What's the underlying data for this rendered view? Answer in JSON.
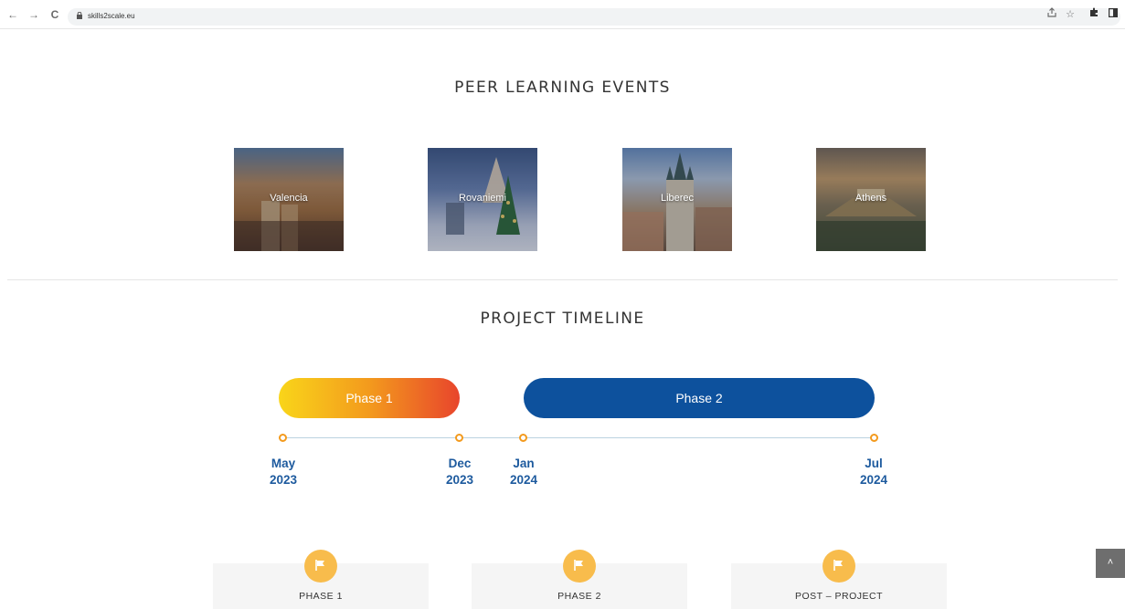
{
  "browser": {
    "url": "skills2scale.eu",
    "nav_back": "←",
    "nav_forward": "→",
    "nav_reload": "C",
    "share_icon": "share-icon",
    "bookmark_icon": "star-icon",
    "extensions_icon": "puzzle-icon",
    "sidepanel_icon": "sidepanel-icon"
  },
  "peer_learning": {
    "title": "PEER LEARNING EVENTS",
    "cities": [
      {
        "label": "Valencia"
      },
      {
        "label": "Rovaniemi"
      },
      {
        "label": "Liberec"
      },
      {
        "label": "Athens"
      }
    ]
  },
  "timeline": {
    "title": "PROJECT TIMELINE",
    "phases": [
      {
        "label": "Phase 1"
      },
      {
        "label": "Phase 2"
      }
    ],
    "dates": [
      {
        "month": "May",
        "year": "2023"
      },
      {
        "month": "Dec",
        "year": "2023"
      },
      {
        "month": "Jan",
        "year": "2024"
      },
      {
        "month": "Jul",
        "year": "2024"
      }
    ]
  },
  "stages": [
    {
      "label": "PHASE 1",
      "icon": "flag-icon"
    },
    {
      "label": "PHASE 2",
      "icon": "flag-icon"
    },
    {
      "label": "POST – PROJECT",
      "icon": "flag-icon"
    }
  ],
  "back_to_top": {
    "label": "˄",
    "icon": "chevron-up-icon"
  },
  "colors": {
    "phase1_gradient": [
      "#f9d51a",
      "#f39a1d",
      "#e8452c"
    ],
    "phase2": "#0d519d",
    "date_text": "#1d5a9e",
    "dot_border": "#f39a1d",
    "flag_circle": "#f8bc4c"
  }
}
